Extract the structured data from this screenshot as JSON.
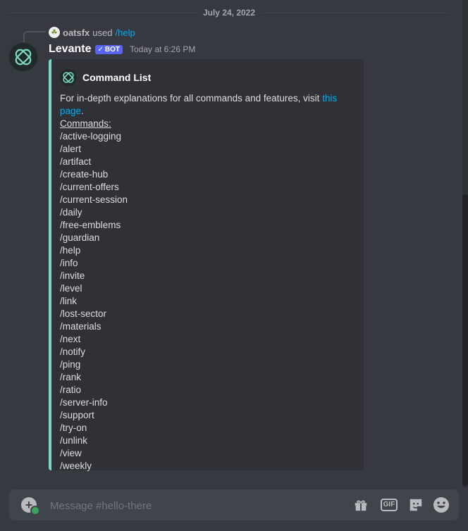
{
  "date_divider": "July 24, 2022",
  "reply": {
    "username": "oatsfx",
    "used_text": "used",
    "command": "/help"
  },
  "message": {
    "author": "Levante",
    "bot_badge": "BOT",
    "timestamp": "Today at 6:26 PM"
  },
  "embed": {
    "accent_color": "#7dd8c5",
    "title": "Command List",
    "description_prefix": "For in-depth explanations for all commands and features, visit ",
    "description_link": "this page",
    "description_suffix": ".",
    "commands_heading": "Commands:",
    "commands": [
      "/active-logging",
      "/alert",
      "/artifact",
      "/create-hub",
      "/current-offers",
      "/current-session",
      "/daily",
      "/free-emblems",
      "/guardian",
      "/help",
      "/info",
      "/invite",
      "/level",
      "/link",
      "/lost-sector",
      "/materials",
      "/next",
      "/notify",
      "/ping",
      "/rank",
      "/ratio",
      "/server-info",
      "/support",
      "/try-on",
      "/unlink",
      "/view",
      "/weekly"
    ]
  },
  "composer": {
    "placeholder": "Message #hello-there",
    "gif_label": "GIF",
    "icons": [
      "add-attachment-icon",
      "gift-icon",
      "gif-icon",
      "sticker-icon",
      "emoji-icon"
    ]
  },
  "colors": {
    "background": "#36393f",
    "link": "#00aff4",
    "bot_badge": "#5865f2"
  }
}
